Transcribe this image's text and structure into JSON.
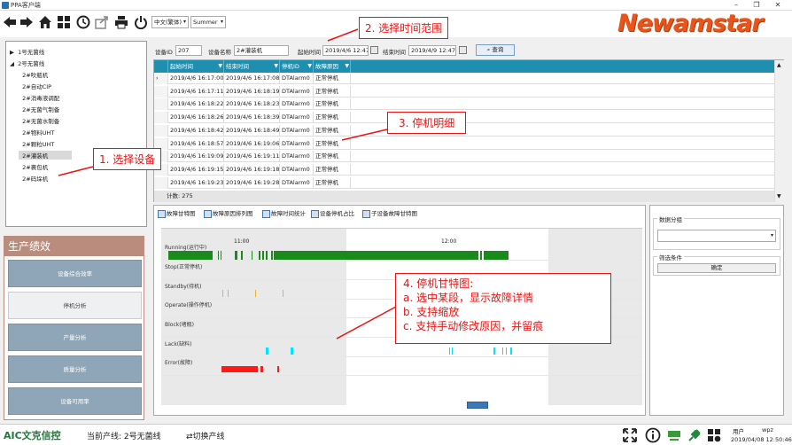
{
  "window": {
    "title": "PPA客户端",
    "min": "–",
    "max": "❐",
    "close": "✕"
  },
  "toolbar": {
    "language": "中文(繁体)",
    "theme": "Summer",
    "icons": [
      "back-icon",
      "forward-icon",
      "home-icon",
      "grid-icon",
      "history-icon",
      "export-icon",
      "print-icon",
      "power-icon"
    ]
  },
  "brand": {
    "logo_text": "Newamstar",
    "color": "#e8541a"
  },
  "tree": {
    "items": [
      {
        "label": "1号无菌线",
        "level": 0,
        "expander": "▶"
      },
      {
        "label": "2号无菌线",
        "level": 0,
        "expander": "◢"
      },
      {
        "label": "2#吹瓶机",
        "level": 1
      },
      {
        "label": "2#自动CIP",
        "level": 1
      },
      {
        "label": "2#消毒液调配",
        "level": 1
      },
      {
        "label": "2#无菌气制备",
        "level": 1
      },
      {
        "label": "2#无菌水制备",
        "level": 1
      },
      {
        "label": "2#物料UHT",
        "level": 1
      },
      {
        "label": "2#颗粒UHT",
        "level": 1
      },
      {
        "label": "2#灌装机",
        "level": 1,
        "selected": true
      },
      {
        "label": "2#裹包机",
        "level": 1
      },
      {
        "label": "2#码垛机",
        "level": 1
      }
    ]
  },
  "production": {
    "title": "生产绩效",
    "buttons": [
      {
        "label": "设备综合效率",
        "active": false
      },
      {
        "label": "停机分析",
        "active": true
      },
      {
        "label": "产量分析",
        "active": false
      },
      {
        "label": "质量分析",
        "active": false
      },
      {
        "label": "设备可用率",
        "active": false
      }
    ]
  },
  "filter": {
    "device_id_label": "设备ID",
    "device_id": "207",
    "device_name_label": "设备名称",
    "device_name": "2#灌装机",
    "start_label": "起始时间",
    "start_value": "2019/4/6 12:47",
    "end_label": "结束时间",
    "end_value": "2019/4/9 12:47",
    "query_label": "查询"
  },
  "table": {
    "columns": [
      "起始时间",
      "结束时间",
      "停机ID",
      "故障原因"
    ],
    "filter_glyph": "▼",
    "row_pointer": "›",
    "rows": [
      [
        "2019/4/6 16:17:00",
        "2019/4/6 16:17:08",
        "DTAlarm0",
        "正常停机"
      ],
      [
        "2019/4/6 16:17:11",
        "2019/4/6 16:18:19",
        "DTAlarm0",
        "正常停机"
      ],
      [
        "2019/4/6 16:18:22",
        "2019/4/6 16:18:23",
        "DTAlarm0",
        "正常停机"
      ],
      [
        "2019/4/6 16:18:26",
        "2019/4/6 16:18:39",
        "DTAlarm0",
        "正常停机"
      ],
      [
        "2019/4/6 16:18:42",
        "2019/4/6 16:18:49",
        "DTAlarm0",
        "正常停机"
      ],
      [
        "2019/4/6 16:18:57",
        "2019/4/6 16:19:06",
        "DTAlarm0",
        "正常停机"
      ],
      [
        "2019/4/6 16:19:09",
        "2019/4/6 16:19:11",
        "DTAlarm0",
        "正常停机"
      ],
      [
        "2019/4/6 16:19:15",
        "2019/4/6 16:19:18",
        "DTAlarm0",
        "正常停机"
      ],
      [
        "2019/4/6 16:19:23",
        "2019/4/6 16:19:28",
        "DTAlarm0",
        "正常停机"
      ]
    ],
    "count_label": "计数: 275",
    "scroll_up": "▲",
    "scroll_down": "▼"
  },
  "chart_tabs": [
    "故障甘特图",
    "故障原因排列图",
    "故障时间统计",
    "设备停机占比",
    "子设备故障甘特图"
  ],
  "chart_data": {
    "type": "gantt",
    "time_ticks": [
      "11:00",
      "12:00"
    ],
    "states": [
      {
        "name": "Running(运行中)",
        "color": "#1a8a1a"
      },
      {
        "name": "Stop(正常停机)",
        "color": "#888888"
      },
      {
        "name": "Standby(待机)",
        "color": "#f0b030"
      },
      {
        "name": "Operate(操作停机)",
        "color": "#888888"
      },
      {
        "name": "Block(堵瓶)",
        "color": "#888888"
      },
      {
        "name": "Lack(缺料)",
        "color": "#00e5ff"
      },
      {
        "name": "Error(故障)",
        "color": "#ff1a1a"
      }
    ]
  },
  "right_panel": {
    "group_label": "数据分组",
    "group_select": "",
    "filter_label": "筛选条件",
    "confirm_label": "确定"
  },
  "annotations": {
    "a1": "1. 选择设备",
    "a2": "2. 选择时间范围",
    "a3": "3. 停机明细",
    "a4_lines": [
      "4. 停机甘特图:",
      "a.  选中某段，显示故障详情",
      "b.  支持缩放",
      "c.  支持手动修改原因，并留痕"
    ]
  },
  "status": {
    "brand": "AIC文克信控",
    "current_line_label": "当前产线: 2号无菌线",
    "switch_line_label": "切换产线",
    "user_label": "用户",
    "user_name": "wpz",
    "datetime": "2019/04/08 12:50:46"
  }
}
